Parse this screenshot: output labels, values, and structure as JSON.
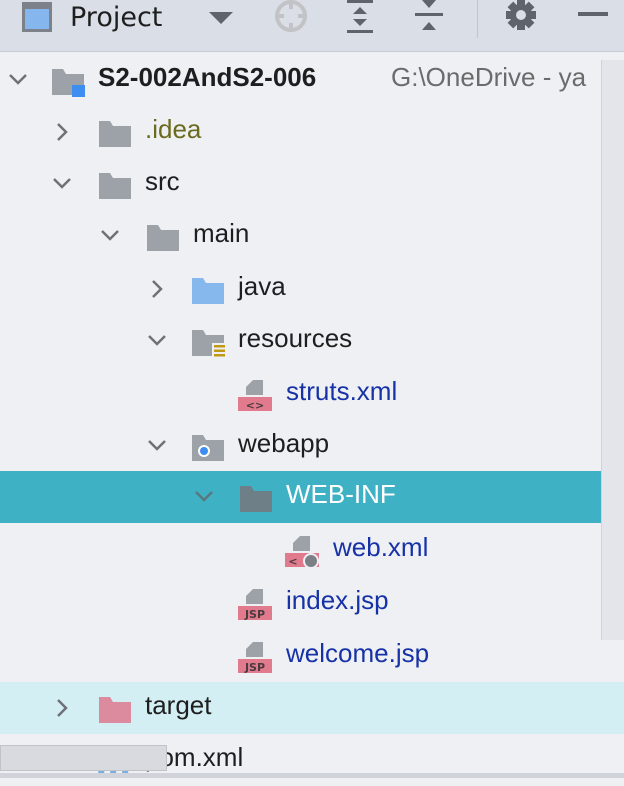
{
  "header": {
    "title": "Project",
    "icons": [
      "project-view-icon",
      "dropdown-arrow-icon",
      "locate-icon",
      "expand-all-icon",
      "collapse-all-icon",
      "gear-icon",
      "minimize-icon"
    ]
  },
  "tree": {
    "items": [
      {
        "label": "S2-002AndS2-006",
        "path": "G:\\OneDrive - ya",
        "level": 0,
        "chevron": "down",
        "icon": "module-folder",
        "color": "#1e1e1e",
        "bold": true
      },
      {
        "label": ".idea",
        "level": 1,
        "chevron": "right",
        "icon": "folder",
        "color": "#6b6b1e"
      },
      {
        "label": "src",
        "level": 1,
        "chevron": "down",
        "icon": "folder",
        "color": "#1e1e1e"
      },
      {
        "label": "main",
        "level": 2,
        "chevron": "down",
        "icon": "folder",
        "color": "#1e1e1e"
      },
      {
        "label": "java",
        "level": 3,
        "chevron": "right",
        "icon": "source-folder",
        "color": "#1e1e1e"
      },
      {
        "label": "resources",
        "level": 3,
        "chevron": "down",
        "icon": "resources-folder",
        "color": "#1e1e1e"
      },
      {
        "label": "struts.xml",
        "level": 4,
        "chevron": "none",
        "icon": "xml-file",
        "color": "#1632a6"
      },
      {
        "label": "webapp",
        "level": 3,
        "chevron": "down",
        "icon": "web-folder",
        "color": "#1e1e1e"
      },
      {
        "label": "WEB-INF",
        "level": 4,
        "chevron": "down",
        "icon": "folder",
        "color": "#ffffff",
        "selected": true
      },
      {
        "label": "web.xml",
        "level": 5,
        "chevron": "none",
        "icon": "web-xml-file",
        "color": "#1632a6"
      },
      {
        "label": "index.jsp",
        "level": 4,
        "chevron": "none",
        "icon": "jsp-file",
        "color": "#1632a6"
      },
      {
        "label": "welcome.jsp",
        "level": 4,
        "chevron": "none",
        "icon": "jsp-file",
        "color": "#1632a6"
      },
      {
        "label": "target",
        "level": 1,
        "chevron": "right",
        "icon": "excluded-folder",
        "color": "#1e1e1e",
        "highlighted": true
      },
      {
        "label": "pom.xml",
        "level": 1,
        "chevron": "none",
        "icon": "maven-file",
        "color": "#1e1e1e"
      }
    ]
  },
  "colors": {
    "selection": "#3fb1c4",
    "excluded_highlight": "#d3eff4",
    "file_link": "#1632a6",
    "folder": "#9da1a8"
  }
}
